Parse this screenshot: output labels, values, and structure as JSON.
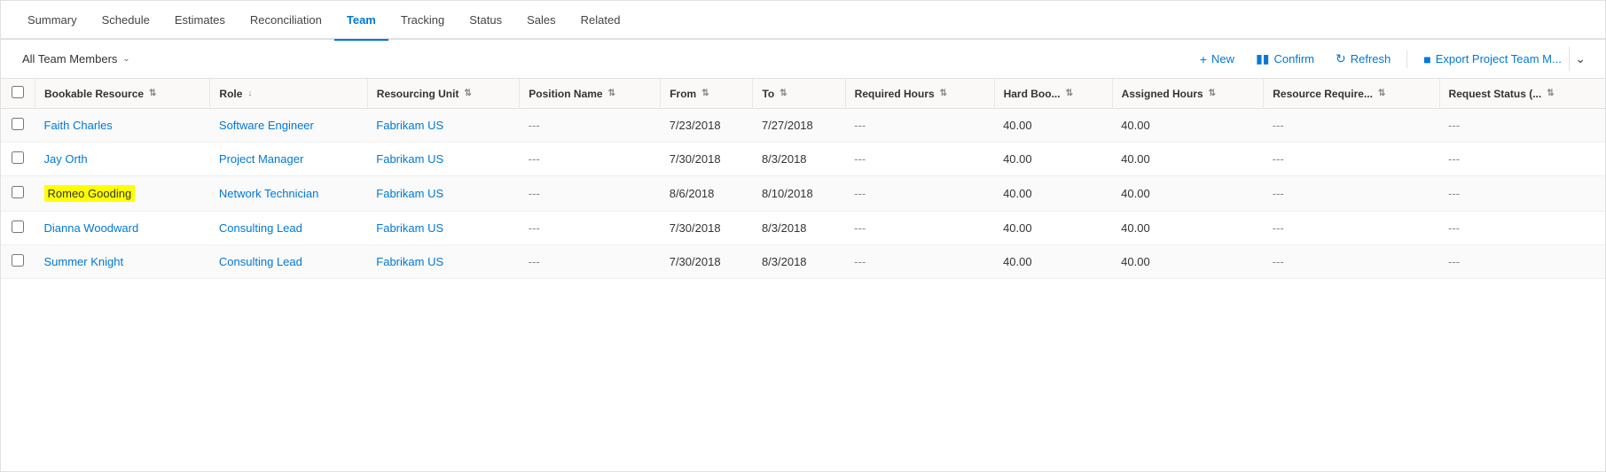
{
  "nav": {
    "tabs": [
      {
        "id": "summary",
        "label": "Summary",
        "active": false
      },
      {
        "id": "schedule",
        "label": "Schedule",
        "active": false
      },
      {
        "id": "estimates",
        "label": "Estimates",
        "active": false
      },
      {
        "id": "reconciliation",
        "label": "Reconciliation",
        "active": false
      },
      {
        "id": "team",
        "label": "Team",
        "active": true
      },
      {
        "id": "tracking",
        "label": "Tracking",
        "active": false
      },
      {
        "id": "status",
        "label": "Status",
        "active": false
      },
      {
        "id": "sales",
        "label": "Sales",
        "active": false
      },
      {
        "id": "related",
        "label": "Related",
        "active": false
      }
    ]
  },
  "toolbar": {
    "filter_label": "All Team Members",
    "new_label": "New",
    "confirm_label": "Confirm",
    "refresh_label": "Refresh",
    "export_label": "Export Project Team M..."
  },
  "table": {
    "columns": [
      {
        "id": "bookable-resource",
        "label": "Bookable Resource",
        "sort": true
      },
      {
        "id": "role",
        "label": "Role",
        "sort": true
      },
      {
        "id": "resourcing-unit",
        "label": "Resourcing Unit",
        "sort": true
      },
      {
        "id": "position-name",
        "label": "Position Name",
        "sort": true
      },
      {
        "id": "from",
        "label": "From",
        "sort": true
      },
      {
        "id": "to",
        "label": "To",
        "sort": true
      },
      {
        "id": "required-hours",
        "label": "Required Hours",
        "sort": true
      },
      {
        "id": "hard-boo",
        "label": "Hard Boo...",
        "sort": true
      },
      {
        "id": "assigned-hours",
        "label": "Assigned Hours",
        "sort": true
      },
      {
        "id": "resource-require",
        "label": "Resource Require...",
        "sort": true
      },
      {
        "id": "request-status",
        "label": "Request Status (...",
        "sort": true
      }
    ],
    "rows": [
      {
        "id": "row-1",
        "bookable_resource": "Faith Charles",
        "role": "Software Engineer",
        "resourcing_unit": "Fabrikam US",
        "position_name": "---",
        "from": "7/23/2018",
        "to": "7/27/2018",
        "required_hours": "---",
        "hard_boo": "40.00",
        "assigned_hours": "40.00",
        "resource_require": "---",
        "request_status": "---",
        "highlighted": false
      },
      {
        "id": "row-2",
        "bookable_resource": "Jay Orth",
        "role": "Project Manager",
        "resourcing_unit": "Fabrikam US",
        "position_name": "---",
        "from": "7/30/2018",
        "to": "8/3/2018",
        "required_hours": "---",
        "hard_boo": "40.00",
        "assigned_hours": "40.00",
        "resource_require": "---",
        "request_status": "---",
        "highlighted": false
      },
      {
        "id": "row-3",
        "bookable_resource": "Romeo Gooding",
        "role": "Network Technician",
        "resourcing_unit": "Fabrikam US",
        "position_name": "---",
        "from": "8/6/2018",
        "to": "8/10/2018",
        "required_hours": "---",
        "hard_boo": "40.00",
        "assigned_hours": "40.00",
        "resource_require": "---",
        "request_status": "---",
        "highlighted": true
      },
      {
        "id": "row-4",
        "bookable_resource": "Dianna Woodward",
        "role": "Consulting Lead",
        "resourcing_unit": "Fabrikam US",
        "position_name": "---",
        "from": "7/30/2018",
        "to": "8/3/2018",
        "required_hours": "---",
        "hard_boo": "40.00",
        "assigned_hours": "40.00",
        "resource_require": "---",
        "request_status": "---",
        "highlighted": false
      },
      {
        "id": "row-5",
        "bookable_resource": "Summer Knight",
        "role": "Consulting Lead",
        "resourcing_unit": "Fabrikam US",
        "position_name": "---",
        "from": "7/30/2018",
        "to": "8/3/2018",
        "required_hours": "---",
        "hard_boo": "40.00",
        "assigned_hours": "40.00",
        "resource_require": "---",
        "request_status": "---",
        "highlighted": false
      }
    ]
  }
}
